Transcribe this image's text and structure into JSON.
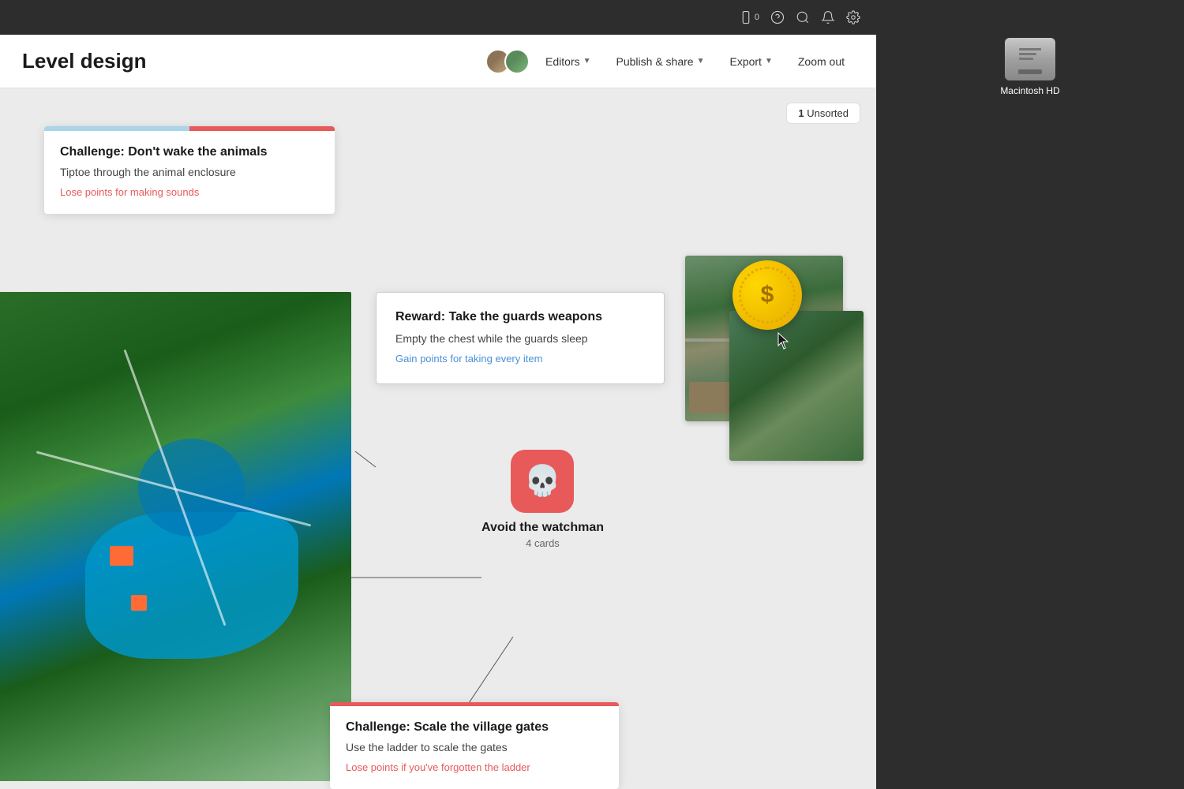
{
  "app": {
    "title": "Level design",
    "topbar": {
      "phone_icon": "📱",
      "badge": "0",
      "help_icon": "?",
      "search_icon": "🔍",
      "bell_icon": "🔔",
      "settings_icon": "⚙"
    },
    "header": {
      "editors_label": "Editors",
      "publish_label": "Publish & share",
      "export_label": "Export",
      "zoom_label": "Zoom out"
    },
    "canvas": {
      "unsorted_count": "1",
      "unsorted_label": "Unsorted"
    }
  },
  "cards": {
    "challenge_1": {
      "title": "Challenge: Don't wake the animals",
      "description": "Tiptoe through the animal enclosure",
      "link": "Lose points for making sounds"
    },
    "reward": {
      "title": "Reward: Take the guards weapons",
      "description": "Empty the chest while the guards sleep",
      "link": "Gain points for taking every item"
    },
    "skull": {
      "label": "Avoid the watchman",
      "cards_count": "4 cards"
    },
    "challenge_2": {
      "title": "Challenge: Scale the village gates",
      "description": "Use the ladder to scale the gates",
      "link": "Lose points if you've forgotten the ladder"
    }
  },
  "mac": {
    "hd_label": "Macintosh HD"
  }
}
